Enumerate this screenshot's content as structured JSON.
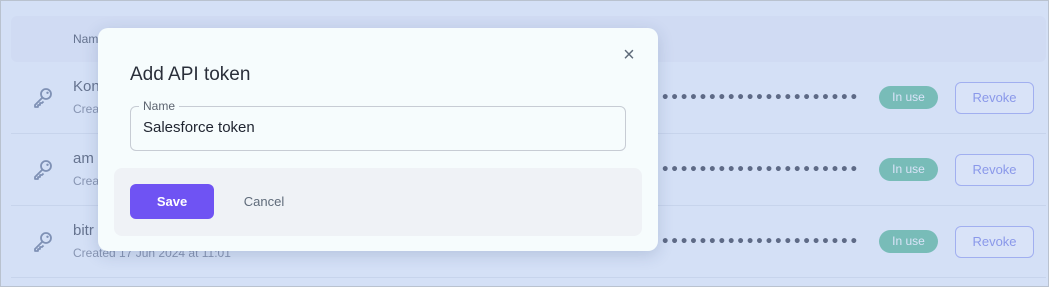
{
  "table": {
    "header_name": "Name",
    "rows": [
      {
        "name": "Kon",
        "created": "Crea",
        "masked": "•••••••••••••••••••••",
        "status": "In use",
        "revoke_label": "Revoke"
      },
      {
        "name": "am",
        "created": "Crea",
        "masked": "•••••••••••••••••••••",
        "status": "In use",
        "revoke_label": "Revoke"
      },
      {
        "name": "bitr",
        "created": "Created 17 Jun 2024 at 11:01",
        "masked": "•••••••••••••••••••••",
        "status": "In use",
        "revoke_label": "Revoke"
      }
    ]
  },
  "modal": {
    "title": "Add API token",
    "close_icon": "close-icon",
    "name_field": {
      "label": "Name",
      "value": "Salesforce token"
    },
    "save_label": "Save",
    "cancel_label": "Cancel"
  },
  "colors": {
    "accent": "#6f53f3",
    "badge": "#4fb98b",
    "revoke": "#7077e5"
  }
}
